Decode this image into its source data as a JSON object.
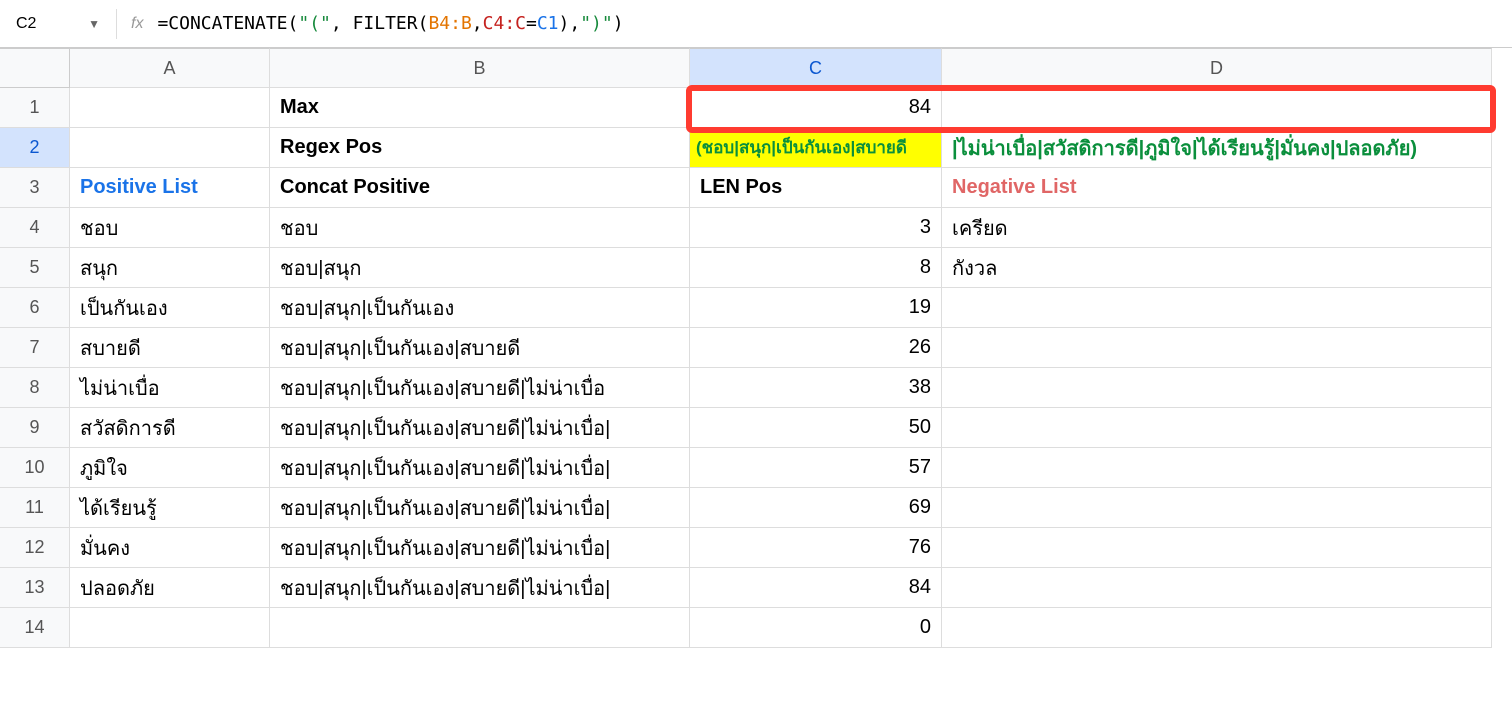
{
  "nameBox": {
    "cellRef": "C2"
  },
  "formulaBar": {
    "parts": {
      "eq": "=",
      "fn1": "CONCATENATE",
      "open1": "(",
      "str1": "\"(\"",
      "comma1": ", ",
      "fn2": "FILTER",
      "open2": "(",
      "rng1": "B4:B",
      "comma2": ",",
      "rng2": "C4:C",
      "eq2": "=",
      "rng3": "C1",
      "close2": ")",
      "comma3": ",",
      "str2": "\")\"",
      "close1": ")"
    }
  },
  "columns": [
    "A",
    "B",
    "C",
    "D"
  ],
  "rows": [
    "1",
    "2",
    "3",
    "4",
    "5",
    "6",
    "7",
    "8",
    "9",
    "10",
    "11",
    "12",
    "13",
    "14"
  ],
  "cells": {
    "B1": "Max",
    "C1": "84",
    "B2": "Regex Pos",
    "C2": "(ชอบ|สนุก|เป็นกันเอง|สบายดี",
    "D2": "|ไม่น่าเบื่อ|สวัสดิการดี|ภูมิใจ|ได้เรียนรู้|มั่นคง|ปลอดภัย)",
    "A3": "Positive List",
    "B3": "Concat Positive",
    "C3": "LEN Pos",
    "D3": "Negative List",
    "A4": "ชอบ",
    "B4": "ชอบ",
    "C4": "3",
    "D4": "เครียด",
    "A5": "สนุก",
    "B5": "ชอบ|สนุก",
    "C5": "8",
    "D5": "กังวล",
    "A6": "เป็นกันเอง",
    "B6": "ชอบ|สนุก|เป็นกันเอง",
    "C6": "19",
    "A7": "สบายดี",
    "B7": "ชอบ|สนุก|เป็นกันเอง|สบายดี",
    "C7": "26",
    "A8": "ไม่น่าเบื่อ",
    "B8": "ชอบ|สนุก|เป็นกันเอง|สบายดี|ไม่น่าเบื่อ",
    "C8": "38",
    "A9": "สวัสดิการดี",
    "B9": "ชอบ|สนุก|เป็นกันเอง|สบายดี|ไม่น่าเบื่อ|",
    "C9": "50",
    "A10": "ภูมิใจ",
    "B10": "ชอบ|สนุก|เป็นกันเอง|สบายดี|ไม่น่าเบื่อ|",
    "C10": "57",
    "A11": "ได้เรียนรู้",
    "B11": "ชอบ|สนุก|เป็นกันเอง|สบายดี|ไม่น่าเบื่อ|",
    "C11": "69",
    "A12": "มั่นคง",
    "B12": "ชอบ|สนุก|เป็นกันเอง|สบายดี|ไม่น่าเบื่อ|",
    "C12": "76",
    "A13": "ปลอดภัย",
    "B13": "ชอบ|สนุก|เป็นกันเอง|สบายดี|ไม่น่าเบื่อ|",
    "C13": "84",
    "C14": "0"
  },
  "selectedColumn": "C",
  "selectedRow": "2"
}
